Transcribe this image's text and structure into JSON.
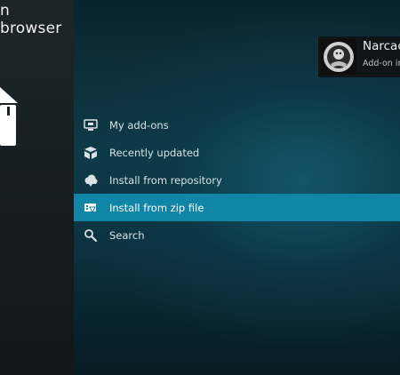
{
  "header": {
    "title": "n browser"
  },
  "menu": {
    "items": [
      {
        "label": "My add-ons",
        "icon": "monitor-icon"
      },
      {
        "label": "Recently updated",
        "icon": "open-box-icon"
      },
      {
        "label": "Install from repository",
        "icon": "cloud-download-icon"
      },
      {
        "label": "Install from zip file",
        "icon": "zip-install-icon",
        "selected": true
      },
      {
        "label": "Search",
        "icon": "search-icon"
      }
    ]
  },
  "notification": {
    "title": "Narcac",
    "subtitle": "Add-on in",
    "icon": "addon-thumbnail"
  },
  "colors": {
    "selected": "#1185a6",
    "background": "#0e3a47",
    "sidebar": "#1a2326"
  }
}
